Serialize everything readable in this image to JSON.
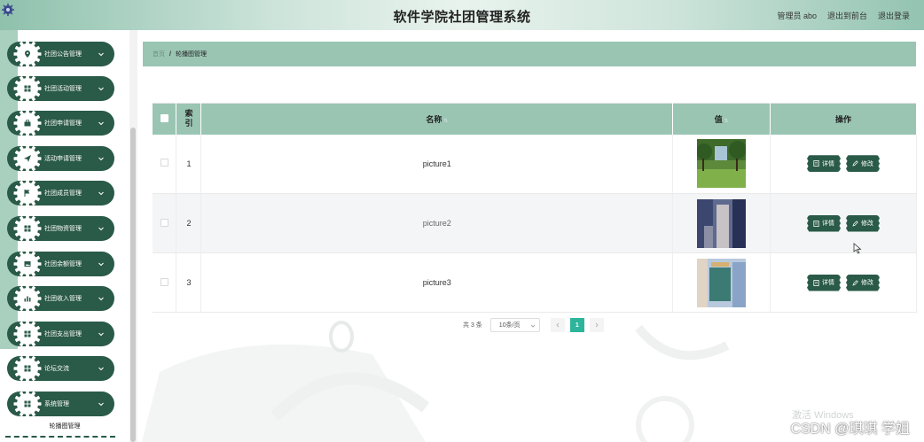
{
  "header": {
    "title": "软件学院社团管理系统",
    "user_label": "管理员 abo",
    "front_link": "退出到前台",
    "logout_link": "退出登录"
  },
  "sidebar": {
    "items": [
      {
        "label": "社团公告管理",
        "icon": "location-icon"
      },
      {
        "label": "社团活动管理",
        "icon": "grid-icon"
      },
      {
        "label": "社团申请管理",
        "icon": "briefcase-icon"
      },
      {
        "label": "活动申请管理",
        "icon": "send-icon"
      },
      {
        "label": "社团成员管理",
        "icon": "flag-icon"
      },
      {
        "label": "社团物资管理",
        "icon": "grid-icon"
      },
      {
        "label": "社团余额管理",
        "icon": "image-icon"
      },
      {
        "label": "社团收入管理",
        "icon": "bar-chart-icon"
      },
      {
        "label": "社团支出管理",
        "icon": "grid-icon"
      },
      {
        "label": "论坛交流",
        "icon": "grid-icon"
      },
      {
        "label": "系统管理",
        "icon": "grid-icon"
      }
    ],
    "submenu_active": "轮播图管理"
  },
  "breadcrumb": {
    "home": "首页",
    "separator": "/",
    "current": "轮播图管理"
  },
  "table": {
    "columns": {
      "index": "索引",
      "name": "名称",
      "value": "值",
      "actions": "操作"
    },
    "rows": [
      {
        "index": "1",
        "name": "picture1"
      },
      {
        "index": "2",
        "name": "picture2"
      },
      {
        "index": "3",
        "name": "picture3"
      }
    ],
    "detail_label": "详情",
    "edit_label": "修改"
  },
  "pagination": {
    "total_text": "共 3 条",
    "page_size": "10条/页",
    "current_page": "1"
  },
  "watermark": "激活 Windows",
  "csdn_mark": "CSDN @琪琪 学姐",
  "colors": {
    "primary_dark": "#2a5a48",
    "header_green": "#9ac5b3",
    "active_page": "#2db59b"
  }
}
